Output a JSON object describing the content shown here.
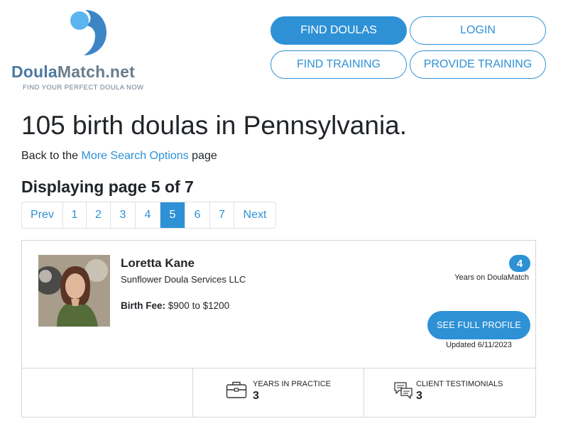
{
  "logo": {
    "name_part1": "Doula",
    "name_part2": "Match.net",
    "tagline": "FIND YOUR PERFECT DOULA NOW",
    "colors": {
      "dark_blue": "#4a79a0",
      "light_blue": "#5bb5f0",
      "gray": "#6a7c8c"
    }
  },
  "nav": {
    "find_doulas": "FIND DOULAS",
    "login": "LOGIN",
    "find_training": "FIND TRAINING",
    "provide_training": "PROVIDE TRAINING"
  },
  "page": {
    "title": "105 birth doulas in Pennsylvania.",
    "back_prefix": "Back to the",
    "back_link": "More Search Options",
    "back_suffix": "page",
    "displaying": "Displaying page 5 of 7"
  },
  "pagination": {
    "prev": "Prev",
    "pages": [
      "1",
      "2",
      "3",
      "4",
      "5",
      "6",
      "7"
    ],
    "active": "5",
    "next": "Next"
  },
  "doula": {
    "photo_icon": "doula-photo",
    "name": "Loretta Kane",
    "business": "Sunflower Doula Services LLC",
    "fee_label": "Birth Fee:",
    "fee_value": "$900 to $1200",
    "years_on_site": "4",
    "years_on_site_label": "Years on DoulaMatch",
    "profile_button": "SEE FULL PROFILE",
    "updated": "Updated 6/11/2023",
    "stats": {
      "years_label": "YEARS IN PRACTICE",
      "years_value": "3",
      "years_icon": "briefcase-icon",
      "testimonials_label": "CLIENT TESTIMONIALS",
      "testimonials_value": "3",
      "testimonials_icon": "chat-bubbles-icon"
    }
  },
  "colors": {
    "accent": "#2e91d6",
    "border": "#d6d6d6",
    "text": "#212529"
  }
}
